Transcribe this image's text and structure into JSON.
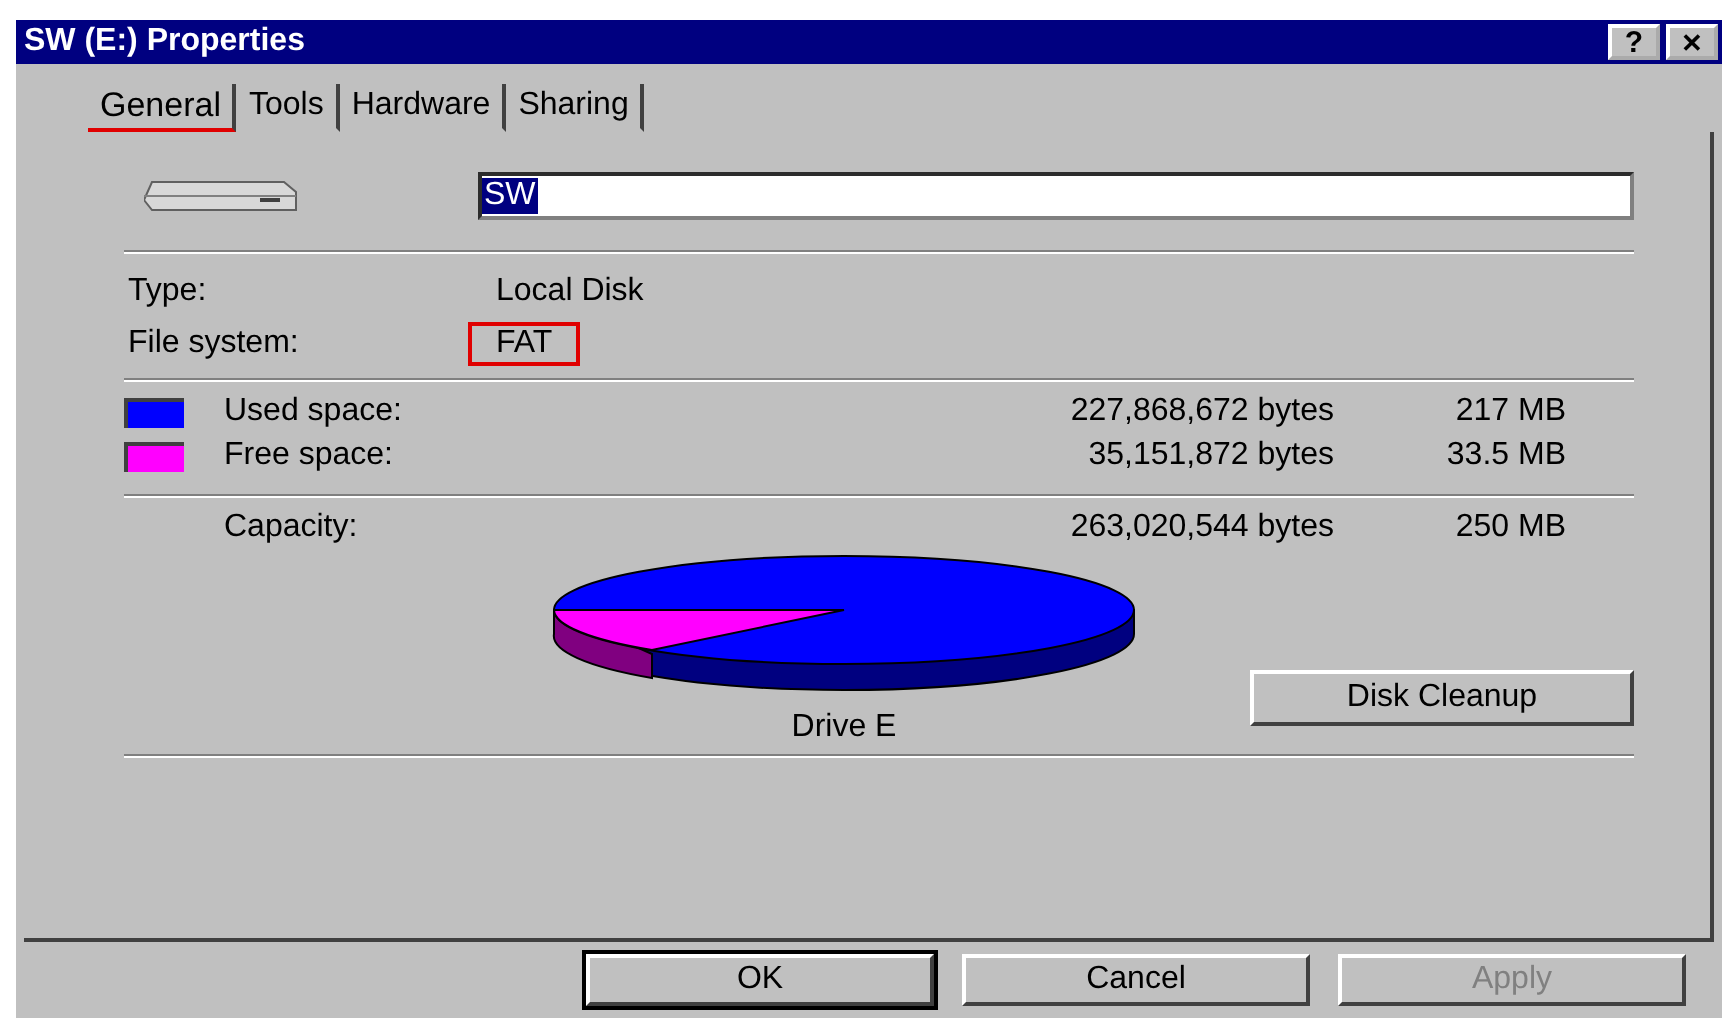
{
  "window": {
    "title": "SW (E:) Properties",
    "buttons": [
      {
        "kind": "help",
        "label": "?"
      },
      {
        "kind": "close",
        "label": "✕"
      }
    ]
  },
  "tabs": [
    {
      "label": "General",
      "selected": true,
      "highlighted": true
    },
    {
      "label": "Tools",
      "selected": false,
      "highlighted": false
    },
    {
      "label": "Hardware",
      "selected": false,
      "highlighted": false
    },
    {
      "label": "Sharing",
      "selected": false,
      "highlighted": false
    }
  ],
  "name_field": {
    "value": "SW"
  },
  "info": [
    {
      "label": "Type:",
      "value": "Local Disk",
      "highlighted": false
    },
    {
      "label": "File system:",
      "value": "FAT",
      "highlighted": true
    }
  ],
  "space": [
    {
      "label": "Used space:",
      "bytes": "227,868,672 bytes",
      "size": "217 MB",
      "color": "#0000ff"
    },
    {
      "label": "Free space:",
      "bytes": "35,151,872 bytes",
      "size": "33.5 MB",
      "color": "#ff00ff"
    }
  ],
  "capacity": {
    "label": "Capacity:",
    "bytes": "263,020,544 bytes",
    "size": "250 MB"
  },
  "pie": {
    "caption": "Drive E"
  },
  "cleanup_button": "Disk Cleanup",
  "buttons": [
    {
      "label": "OK",
      "disabled": false,
      "default": true
    },
    {
      "label": "Cancel",
      "disabled": false,
      "default": false
    },
    {
      "label": "Apply",
      "disabled": true,
      "default": false
    }
  ]
}
